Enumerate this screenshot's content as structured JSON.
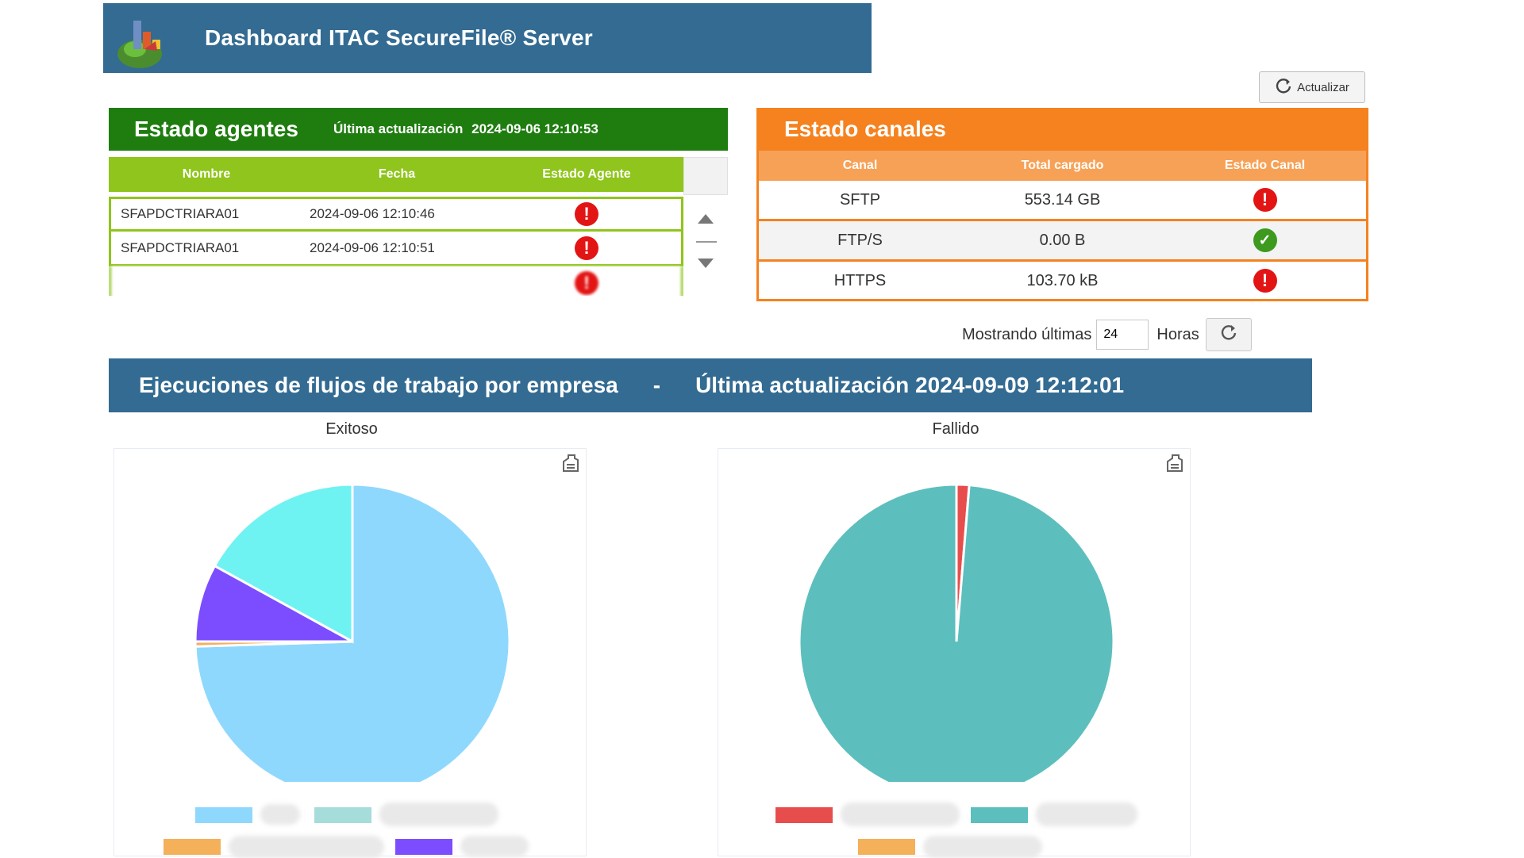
{
  "header": {
    "title": "Dashboard ITAC SecureFile® Server"
  },
  "toolbar": {
    "refresh_label": "Actualizar"
  },
  "agents": {
    "title": "Estado agentes",
    "last_update_label": "Última actualización",
    "last_update_value": "2024-09-06 12:10:53",
    "columns": [
      "Nombre",
      "Fecha",
      "Estado Agente"
    ],
    "rows": [
      {
        "name": "SFAPDCTRIARA01",
        "date": "2024-09-06 12:10:46",
        "status": "error"
      },
      {
        "name": "SFAPDCTRIARA01",
        "date": "2024-09-06 12:10:51",
        "status": "error"
      }
    ]
  },
  "channels": {
    "title": "Estado canales",
    "columns": [
      "Canal",
      "Total cargado",
      "Estado Canal"
    ],
    "rows": [
      {
        "channel": "SFTP",
        "total": "553.14 GB",
        "status": "error"
      },
      {
        "channel": "FTP/S",
        "total": "0.00 B",
        "status": "ok"
      },
      {
        "channel": "HTTPS",
        "total": "103.70 kB",
        "status": "error"
      }
    ]
  },
  "hours": {
    "prefix": "Mostrando últimas",
    "value": "24",
    "suffix": "Horas"
  },
  "executions": {
    "title": "Ejecuciones de flujos de trabajo por empresa",
    "separator": "-",
    "last_update": "Última actualización 2024-09-09 12:12:01"
  },
  "chart_data": [
    {
      "type": "pie",
      "title": "Exitoso",
      "series": [
        {
          "value": 74.5,
          "color": "#8fd8fd"
        },
        {
          "value": 0.5,
          "color": "#f5b05a"
        },
        {
          "value": 8,
          "color": "#7c4dff"
        },
        {
          "value": 17,
          "color": "#6ff2f2"
        }
      ]
    },
    {
      "type": "pie",
      "title": "Fallido",
      "series": [
        {
          "value": 1.3,
          "color": "#e84d4d"
        },
        {
          "value": 98.7,
          "color": "#5cbfbd"
        }
      ]
    }
  ],
  "legend_colors": {
    "left": [
      "#8fd8fd",
      "#a6dcd9",
      "#f5b05a",
      "#7c4dff"
    ],
    "right": [
      "#e84d4d",
      "#5cbfbd",
      "#f5b05a"
    ]
  },
  "icons": {
    "logo": "dashboard-chart-icon",
    "refresh": "refresh-icon",
    "error": "error-icon",
    "ok": "ok-icon",
    "chart_menu": "chart-menu-icon"
  }
}
